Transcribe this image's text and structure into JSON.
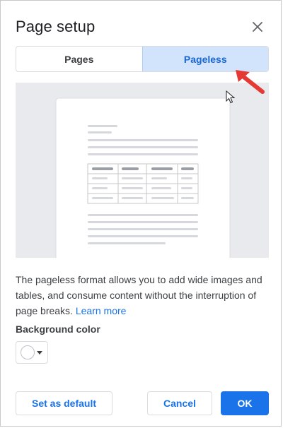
{
  "dialog": {
    "title": "Page setup",
    "close_icon": "close-icon"
  },
  "tabs": [
    {
      "label": "Pages",
      "selected": false
    },
    {
      "label": "Pageless",
      "selected": true
    }
  ],
  "description": {
    "text": "The pageless format allows you to add wide images and tables, and consume content without the interruption of page breaks.",
    "link": "Learn more"
  },
  "background": {
    "label": "Background color",
    "value_color": "#ffffff"
  },
  "buttons": {
    "set_default": "Set as default",
    "cancel": "Cancel",
    "ok": "OK"
  },
  "colors": {
    "accent": "#1a73e8",
    "selected_tab_bg": "#d2e3fc",
    "annotation_arrow": "#e53935"
  }
}
